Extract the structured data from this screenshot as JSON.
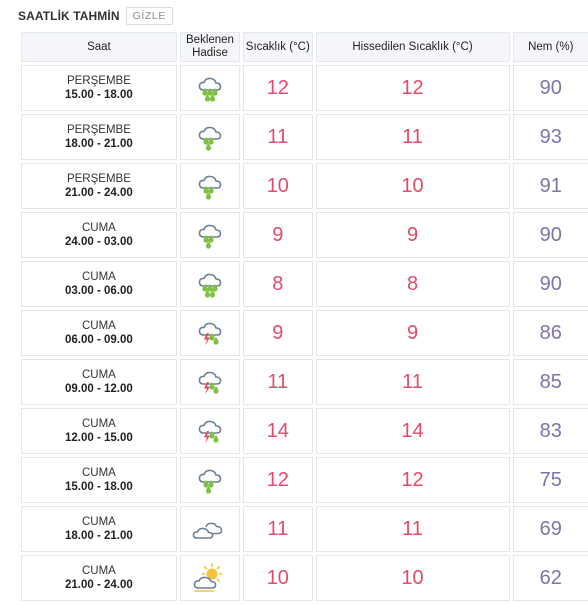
{
  "header": {
    "title": "SAATLİK TAHMİN",
    "toggle_label": "GİZLE"
  },
  "columns": {
    "time": "Saat",
    "event": "Beklenen Hadise",
    "temp": "Sıcaklık (°C)",
    "feels": "Hissedilen Sıcaklık (°C)",
    "humidity": "Nem (%)"
  },
  "colors": {
    "temp": "#e24b6a",
    "humidity": "#7c75a8",
    "rain": "#7fc242",
    "lightning": "#e24b6a",
    "cloud": "#6f8194",
    "sun": "#f5c33b"
  },
  "rows": [
    {
      "day": "PERŞEMBE",
      "time": "15.00 - 18.00",
      "icon": "rain-icon",
      "temp": "12",
      "feels": "12",
      "humidity": "90"
    },
    {
      "day": "PERŞEMBE",
      "time": "18.00 - 21.00",
      "icon": "light-rain-icon",
      "temp": "11",
      "feels": "11",
      "humidity": "93"
    },
    {
      "day": "PERŞEMBE",
      "time": "21.00 - 24.00",
      "icon": "light-rain-icon",
      "temp": "10",
      "feels": "10",
      "humidity": "91"
    },
    {
      "day": "CUMA",
      "time": "24.00 - 03.00",
      "icon": "light-rain-icon",
      "temp": "9",
      "feels": "9",
      "humidity": "90"
    },
    {
      "day": "CUMA",
      "time": "03.00 - 06.00",
      "icon": "rain-icon",
      "temp": "8",
      "feels": "8",
      "humidity": "90"
    },
    {
      "day": "CUMA",
      "time": "06.00 - 09.00",
      "icon": "thunderstorm-icon",
      "temp": "9",
      "feels": "9",
      "humidity": "86"
    },
    {
      "day": "CUMA",
      "time": "09.00 - 12.00",
      "icon": "thunderstorm-icon",
      "temp": "11",
      "feels": "11",
      "humidity": "85"
    },
    {
      "day": "CUMA",
      "time": "12.00 - 15.00",
      "icon": "thunderstorm-icon",
      "temp": "14",
      "feels": "14",
      "humidity": "83"
    },
    {
      "day": "CUMA",
      "time": "15.00 - 18.00",
      "icon": "light-rain-icon",
      "temp": "12",
      "feels": "12",
      "humidity": "75"
    },
    {
      "day": "CUMA",
      "time": "18.00 - 21.00",
      "icon": "cloudy-icon",
      "temp": "11",
      "feels": "11",
      "humidity": "69"
    },
    {
      "day": "CUMA",
      "time": "21.00 - 24.00",
      "icon": "partly-cloudy-icon",
      "temp": "10",
      "feels": "10",
      "humidity": "62"
    }
  ]
}
